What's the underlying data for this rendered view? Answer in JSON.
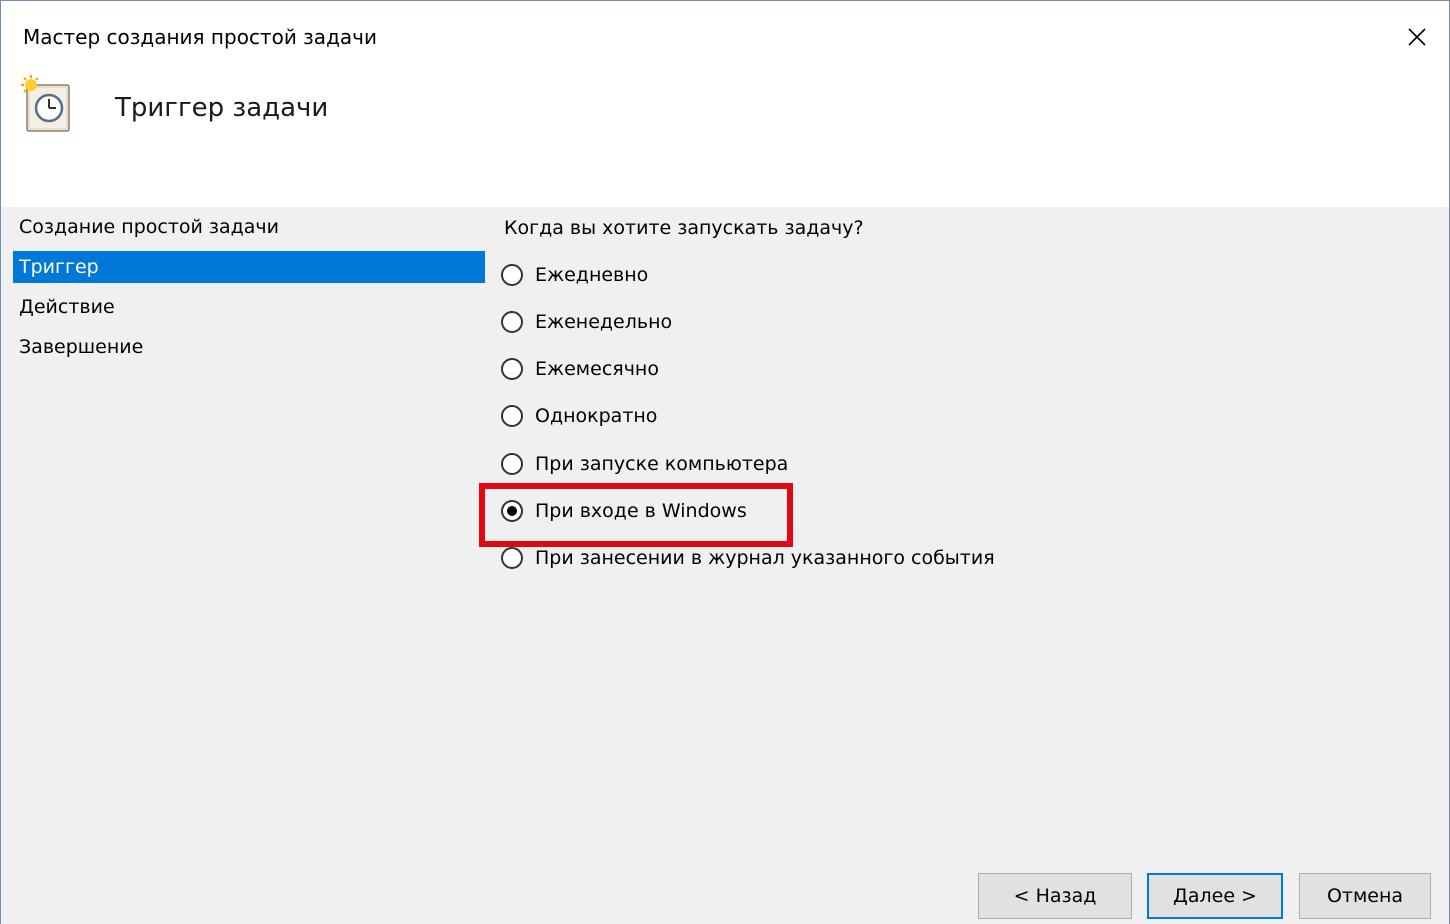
{
  "window": {
    "title": "Мастер создания простой задачи"
  },
  "header": {
    "title": "Триггер задачи",
    "icon": "task-scheduler-clock-icon"
  },
  "steps": [
    {
      "label": "Создание простой задачи",
      "active": false
    },
    {
      "label": "Триггер",
      "active": true
    },
    {
      "label": "Действие",
      "active": false
    },
    {
      "label": "Завершение",
      "active": false
    }
  ],
  "question": "Когда вы хотите запускать задачу?",
  "options": [
    {
      "label": "Ежедневно",
      "checked": false
    },
    {
      "label": "Еженедельно",
      "checked": false
    },
    {
      "label": "Ежемесячно",
      "checked": false
    },
    {
      "label": "Однократно",
      "checked": false
    },
    {
      "label": "При запуске компьютера",
      "checked": false
    },
    {
      "label": "При входе в Windows",
      "checked": true
    },
    {
      "label": "При занесении в журнал указанного события",
      "checked": false
    }
  ],
  "buttons": {
    "back": "< Назад",
    "next": "Далее >",
    "cancel": "Отмена"
  },
  "colors": {
    "accent": "#0078d7",
    "highlight": "#e30613",
    "panel_bg": "#f0f0f0"
  }
}
